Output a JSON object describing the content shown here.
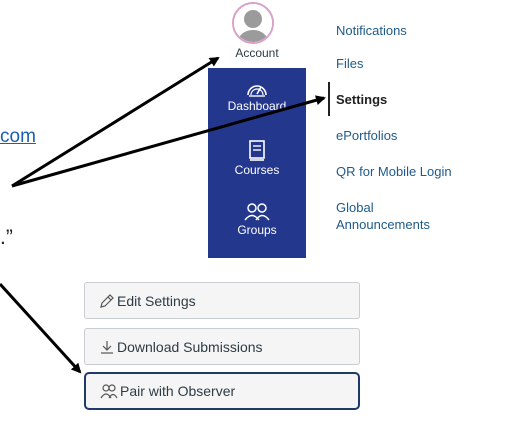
{
  "left_fragments": {
    "link_text": "com",
    "quote_text": ".”"
  },
  "global_nav": {
    "account": {
      "label": "Account",
      "icon": "avatar-icon"
    },
    "items": [
      {
        "label": "Dashboard",
        "icon": "dashboard-icon"
      },
      {
        "label": "Courses",
        "icon": "courses-icon"
      },
      {
        "label": "Groups",
        "icon": "groups-icon"
      }
    ],
    "colors": {
      "nav_bg": "#23378c",
      "avatar_ring": "#d9a0c8"
    }
  },
  "account_menu": {
    "items": [
      {
        "label": "Notifications",
        "active": false
      },
      {
        "label": "Files",
        "active": false
      },
      {
        "label": "Settings",
        "active": true
      },
      {
        "label": "ePortfolios",
        "active": false
      },
      {
        "label": "QR for Mobile Login",
        "active": false
      },
      {
        "label_line1": "Global",
        "label_line2": "Announcements",
        "active": false
      }
    ]
  },
  "settings_buttons": [
    {
      "label": "Edit Settings",
      "icon": "pencil-icon"
    },
    {
      "label": "Download Submissions",
      "icon": "download-icon"
    },
    {
      "label": "Pair with Observer",
      "icon": "pair-users-icon",
      "focused": true
    }
  ]
}
